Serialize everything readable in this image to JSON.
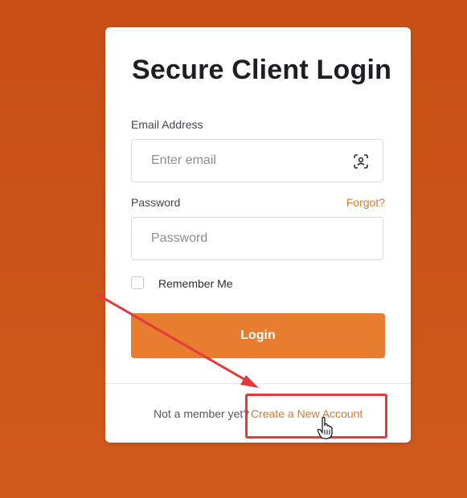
{
  "login_card": {
    "title": "Secure Client Login",
    "email": {
      "label": "Email Address",
      "placeholder": "Enter email",
      "value": ""
    },
    "password": {
      "label": "Password",
      "placeholder": "Password",
      "value": "",
      "forgot_label": "Forgot?"
    },
    "remember_me": {
      "label": "Remember Me",
      "checked": false
    },
    "login_button_label": "Login",
    "footer": {
      "prompt": "Not a member yet?",
      "create_account_label": "Create a New Account"
    }
  },
  "colors": {
    "background": "#cb5418",
    "accent": "#e87c2f",
    "link": "#e0782c",
    "annotation": "#e23b3b"
  },
  "icons": {
    "email_field_icon": "face-scan-icon",
    "pointer": "hand-pointer-icon"
  }
}
